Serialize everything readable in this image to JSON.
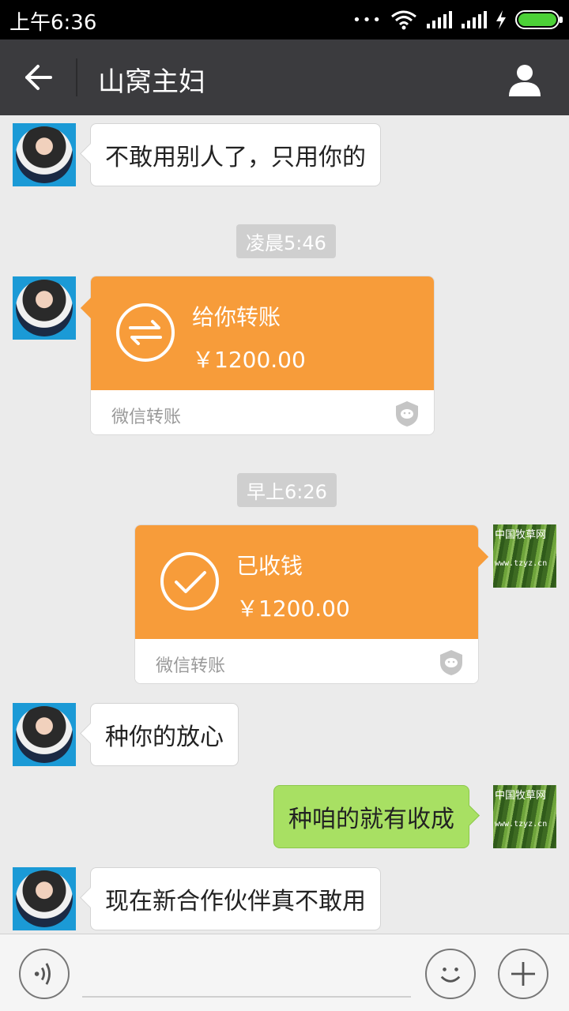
{
  "status_bar": {
    "time": "上午6:36",
    "dots": "•••",
    "battery_color": "#4cd137"
  },
  "header": {
    "title": "山窝主妇",
    "back_icon": "arrow-left-icon",
    "profile_icon": "person-icon"
  },
  "messages": [
    {
      "type": "text",
      "side": "left",
      "text": "不敢用别人了，只用你的"
    },
    {
      "type": "time",
      "text": "凌晨5:46"
    },
    {
      "type": "transfer",
      "side": "left",
      "label": "给你转账",
      "amount": "￥1200.00",
      "service": "微信转账"
    },
    {
      "type": "time",
      "text": "早上6:26"
    },
    {
      "type": "transfer",
      "side": "right",
      "label": "已收钱",
      "amount": "￥1200.00",
      "service": "微信转账"
    },
    {
      "type": "text",
      "side": "left",
      "text": "种你的放心"
    },
    {
      "type": "text",
      "side": "right",
      "text": "种咱的就有收成"
    },
    {
      "type": "text",
      "side": "left",
      "text": "现在新合作伙伴真不敢用"
    }
  ],
  "my_avatar": {
    "watermark": "中国牧草网",
    "watermark_url": "www.tzyz.cn"
  },
  "colors": {
    "header_bg": "#3b3b3e",
    "transfer_orange": "#f79c3a",
    "my_bubble_green": "#a8e063",
    "chat_bg": "#ebebeb"
  },
  "input_bar": {
    "voice_icon": "voice-icon",
    "emoji_icon": "emoji-icon",
    "plus_icon": "plus-icon",
    "placeholder": ""
  }
}
